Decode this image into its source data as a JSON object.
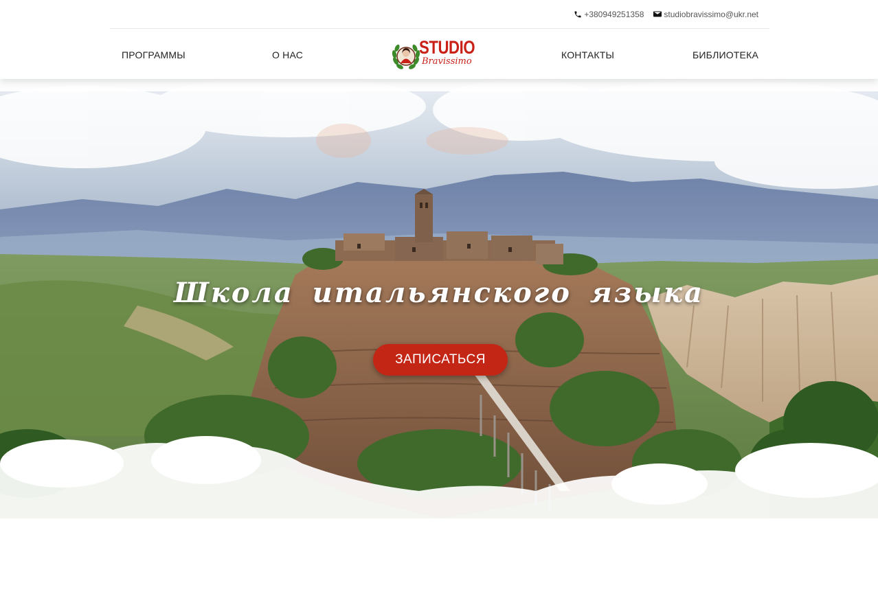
{
  "header": {
    "phone": "+380949251358",
    "email": "studiobravissimo@ukr.net",
    "nav": {
      "programs": "ПРОГРАММЫ",
      "about": "О НАС",
      "contacts": "КОНТАКТЫ",
      "library": "БИБЛИОТЕКА"
    },
    "logo": {
      "title": "STUDIO",
      "subtitle": "Bravissimo"
    }
  },
  "hero": {
    "title": "Школа итальянского языка",
    "cta_label": "ЗАПИСАТЬСЯ"
  },
  "icons": {
    "phone": "phone-icon",
    "email": "email-icon",
    "logo_emblem": "laurel-portrait-icon"
  },
  "colors": {
    "brand_red": "#c92018",
    "cta_red": "#c42616",
    "nav_text": "#222222",
    "topbar_text": "#555555"
  }
}
